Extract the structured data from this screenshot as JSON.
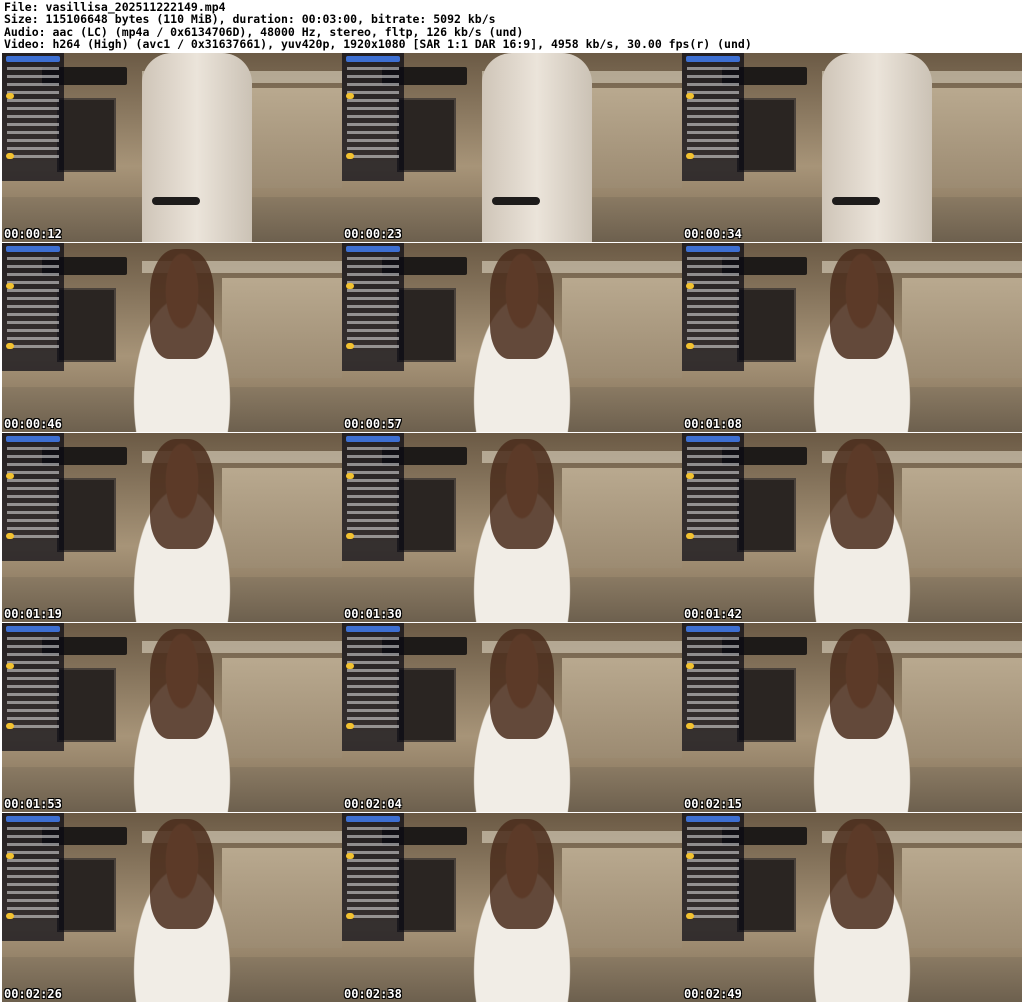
{
  "header": {
    "file_line": "File: vasillisa_202511222149.mp4",
    "size_line": "Size: 115106648 bytes (110 MiB), duration: 00:03:00, bitrate: 5092 kb/s",
    "audio_line": "Audio: aac (LC) (mp4a / 0x6134706D), 48000 Hz, stereo, fltp, 126 kb/s (und)",
    "video_line": "Video: h264 (High) (avc1 / 0x31637661), yuv420p, 1920x1080 [SAR 1:1 DAR 16:9], 4958 kb/s, 30.00 fps(r) (und)"
  },
  "thumbnails": [
    {
      "timestamp": "00:00:12",
      "scene": "chair"
    },
    {
      "timestamp": "00:00:23",
      "scene": "chair"
    },
    {
      "timestamp": "00:00:34",
      "scene": "chair"
    },
    {
      "timestamp": "00:00:46",
      "scene": "person"
    },
    {
      "timestamp": "00:00:57",
      "scene": "person"
    },
    {
      "timestamp": "00:01:08",
      "scene": "person"
    },
    {
      "timestamp": "00:01:19",
      "scene": "person"
    },
    {
      "timestamp": "00:01:30",
      "scene": "person"
    },
    {
      "timestamp": "00:01:42",
      "scene": "person"
    },
    {
      "timestamp": "00:01:53",
      "scene": "person"
    },
    {
      "timestamp": "00:02:04",
      "scene": "person"
    },
    {
      "timestamp": "00:02:15",
      "scene": "person"
    },
    {
      "timestamp": "00:02:26",
      "scene": "person"
    },
    {
      "timestamp": "00:02:38",
      "scene": "person"
    },
    {
      "timestamp": "00:02:49",
      "scene": "person"
    }
  ]
}
